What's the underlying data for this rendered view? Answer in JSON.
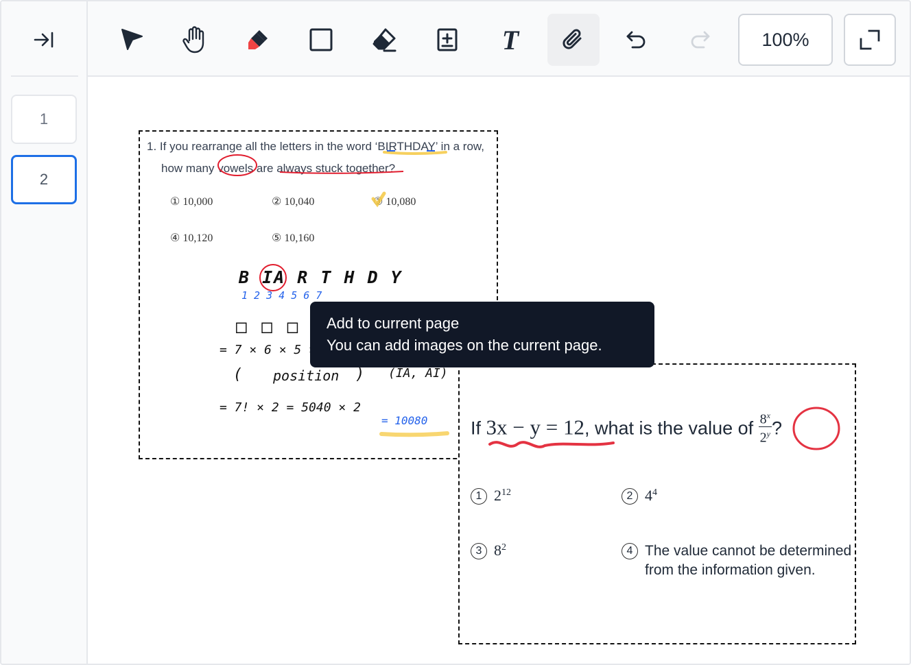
{
  "sidebar": {
    "collapse_icon": "collapse-right-icon",
    "pages": [
      {
        "label": "1",
        "active": false
      },
      {
        "label": "2",
        "active": true
      }
    ]
  },
  "toolbar": {
    "tools": [
      {
        "name": "select",
        "icon": "pointer-arrow-icon"
      },
      {
        "name": "pan",
        "icon": "hand-icon"
      },
      {
        "name": "highlighter",
        "icon": "highlighter-icon",
        "color": "#ef4444"
      },
      {
        "name": "rectangle",
        "icon": "rectangle-icon"
      },
      {
        "name": "eraser",
        "icon": "eraser-icon"
      },
      {
        "name": "add-page",
        "icon": "add-page-icon"
      },
      {
        "name": "text",
        "icon": "text-icon",
        "glyph": "T"
      },
      {
        "name": "attach-image",
        "icon": "paperclip-icon",
        "active": true
      },
      {
        "name": "undo",
        "icon": "undo-icon"
      },
      {
        "name": "redo",
        "icon": "redo-icon",
        "disabled": true
      }
    ],
    "zoom_label": "100%",
    "fullscreen_icon": "fullscreen-icon"
  },
  "question1": {
    "line1_prefix": "1. If you rearrange all the letters in the word ‘",
    "line1_word": "BIRTHDAY",
    "line1_suffix": "’ in a row,",
    "line2_prefix": "how many ",
    "line2_vowels": "vowels",
    "line2_mid": " are ",
    "line2_underlined": "always stuck together",
    "line2_suffix": "?",
    "choices": [
      {
        "mark": "①",
        "value": "10,000"
      },
      {
        "mark": "②",
        "value": "10,040"
      },
      {
        "mark": "③",
        "value": "10,080"
      },
      {
        "mark": "④",
        "value": "10,120"
      },
      {
        "mark": "⑤",
        "value": "10,160"
      }
    ],
    "handwriting": {
      "letters": "B  IA  R  T  H  D  Y",
      "numbers": "1    2    3  4   5   6   7",
      "boxes": "□ □ □ □",
      "calc1": "= 7 × 6 × 5 × 4",
      "paren_open": "(",
      "position": "position",
      "paren_close": ")",
      "pairs": "(IA, AI)",
      "calc2": "= 7! × 2 = 5040 × 2",
      "answer": "= 10080"
    }
  },
  "question2": {
    "prefix": "If ",
    "equation": "3x − y = 12",
    "middle": ", what is the value of ",
    "fraction_num": "8",
    "fraction_num_exp": "x",
    "fraction_den": "2",
    "fraction_den_exp": "y",
    "suffix": "?",
    "choices": [
      {
        "mark": "1",
        "base": "2",
        "exp": "12",
        "text": ""
      },
      {
        "mark": "2",
        "base": "4",
        "exp": "4",
        "text": ""
      },
      {
        "mark": "3",
        "base": "8",
        "exp": "2",
        "text": ""
      },
      {
        "mark": "4",
        "base": "",
        "exp": "",
        "text": "The value cannot be determined",
        "text2": "from the information given."
      }
    ]
  },
  "tooltip": {
    "title": "Add to current page",
    "body": "You can add images on the current page."
  },
  "colors": {
    "accent": "#1d6fe6",
    "annotation_red": "#e11d2e",
    "annotation_yellow": "#f5c842",
    "annotation_blue": "#2563eb",
    "tooltip_bg": "#111827"
  }
}
